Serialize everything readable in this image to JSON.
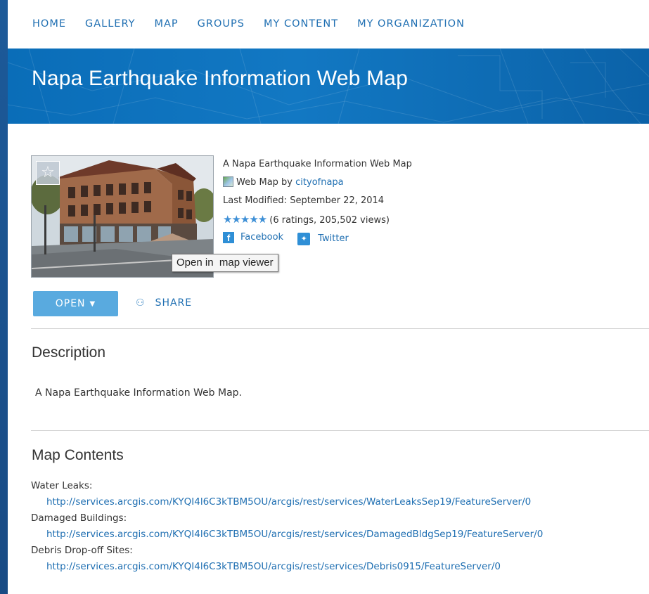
{
  "nav": {
    "items": [
      "HOME",
      "GALLERY",
      "MAP",
      "GROUPS",
      "MY CONTENT",
      "MY ORGANIZATION"
    ]
  },
  "banner": {
    "title": "Napa Earthquake Information Web Map"
  },
  "item": {
    "summary": "A Napa Earthquake Information Web Map",
    "type_label": "Web Map by",
    "owner": "cityofnapa",
    "last_modified": "Last Modified: September 22, 2014",
    "stars": "★★★★★",
    "ratings_views": "(6 ratings, 205,502 views)",
    "facebook": "Facebook",
    "twitter": "Twitter",
    "tooltip": "Open in  map viewer",
    "favorite_icon": "star-icon"
  },
  "actions": {
    "open_label": "OPEN",
    "share_label": "SHARE"
  },
  "description": {
    "heading": "Description",
    "text": "A Napa Earthquake Information Web Map."
  },
  "map_contents": {
    "heading": "Map Contents",
    "layers": [
      {
        "name": "Water Leaks:",
        "url": "http://services.arcgis.com/KYQI4l6C3kTBM5OU/arcgis/rest/services/WaterLeaksSep19/FeatureServer/0"
      },
      {
        "name": "Damaged Buildings:",
        "url": "http://services.arcgis.com/KYQI4l6C3kTBM5OU/arcgis/rest/services/DamagedBldgSep19/FeatureServer/0"
      },
      {
        "name": "Debris Drop-off Sites:",
        "url": "http://services.arcgis.com/KYQI4l6C3kTBM5OU/arcgis/rest/services/Debris0915/FeatureServer/0"
      }
    ]
  },
  "colors": {
    "accent": "#1f6fb2",
    "banner": "#0a6db8",
    "button": "#59aadf",
    "outer_background": "#1a4f8a"
  }
}
